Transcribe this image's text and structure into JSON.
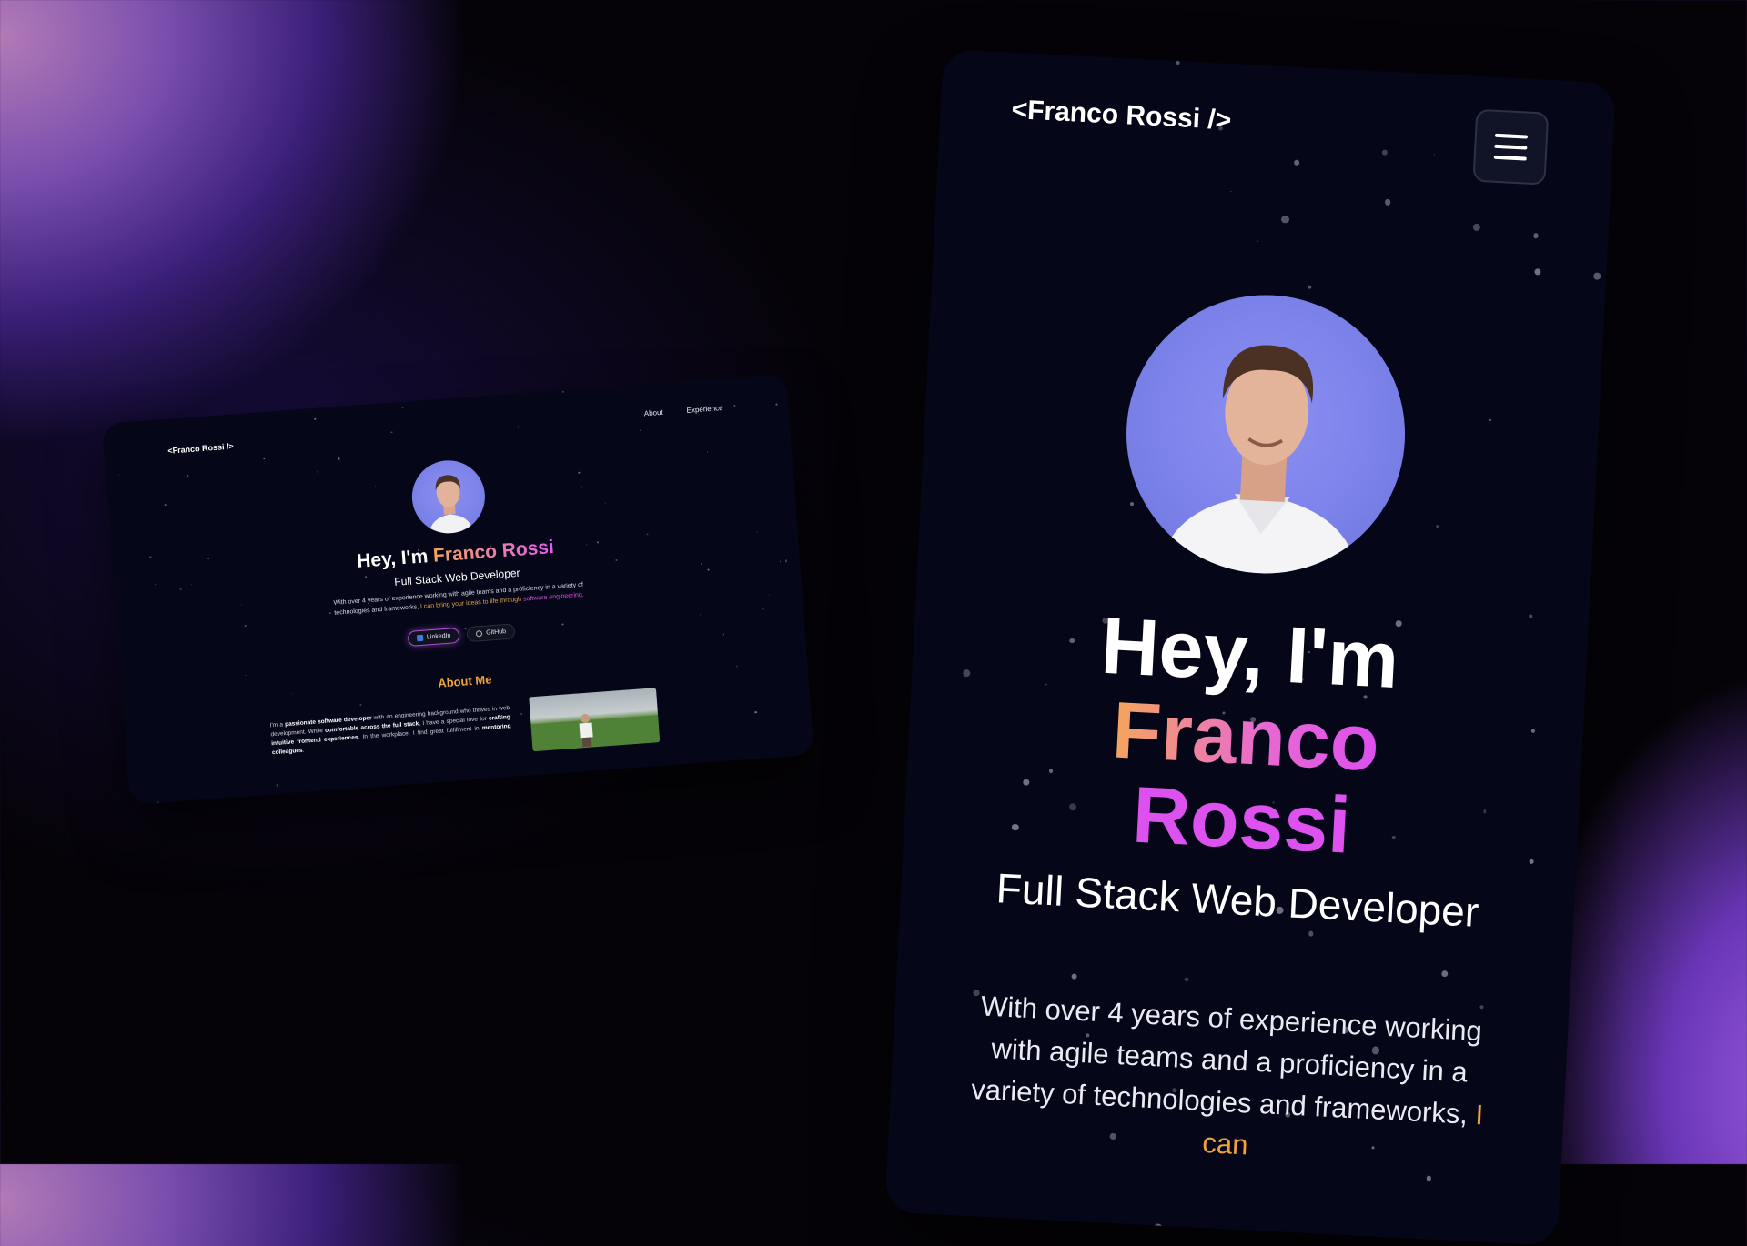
{
  "theme": {
    "accent_orange": "#f0a33b",
    "accent_pink": "#dc4ff0",
    "card_bg": "#050718"
  },
  "desktop": {
    "logo": "<Franco Rossi />",
    "nav": [
      "About",
      "Experience"
    ],
    "greeting": "Hey, I'm ",
    "name": "Franco Rossi",
    "role": "Full Stack Web Developer",
    "intro_plain": "With over 4 years of experience working with agile teams and a proficiency in a variety of technologies and frameworks, ",
    "intro_highlight_orange": "I can bring your ideas to life through",
    "intro_highlight_pink": "software engineering.",
    "buttons": {
      "linkedin": "LinkedIn",
      "github": "GitHub"
    },
    "about_title": "About Me",
    "about": {
      "p1": "I'm a ",
      "b1": "passionate software developer",
      "p2": " with an engineering background who thrives in web development. While ",
      "b2": "comfortable across the full stack",
      "p3": ", I have a special love for ",
      "b3": "crafting intuitive frontend experiences",
      "p4": ". In the workplace, I find great fulfillment in ",
      "b4": "mentoring colleagues",
      "p5": "."
    }
  },
  "mobile": {
    "logo": "<Franco Rossi />",
    "greeting": "Hey, I'm",
    "first_name": "Franco",
    "last_name": "Rossi",
    "role": "Full Stack Web Developer",
    "intro_plain": "With over 4 years of experience working with agile teams and a proficiency in a variety of technologies and frameworks, ",
    "intro_highlight": "I can"
  },
  "icons": {
    "menu": "hamburger-menu-icon",
    "linkedin": "linkedin-icon",
    "github": "github-icon"
  }
}
